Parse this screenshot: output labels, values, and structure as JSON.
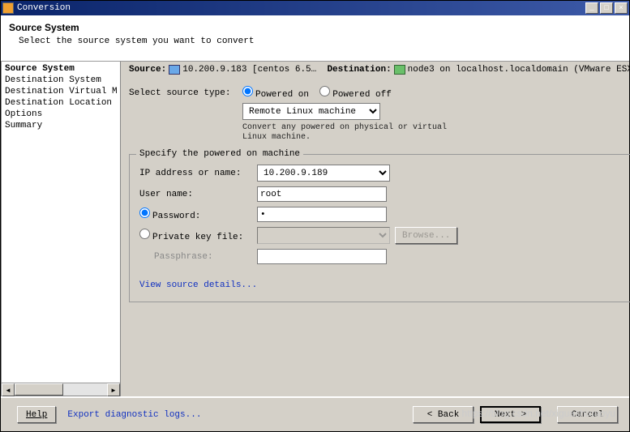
{
  "titlebar": {
    "title": "Conversion"
  },
  "header": {
    "title": "Source System",
    "subtitle": "Select the source system you want to convert"
  },
  "sidebar": {
    "items": [
      "Source System",
      "Destination System",
      "Destination Virtual M",
      "Destination Location",
      "Options",
      "Summary"
    ]
  },
  "srcline": {
    "source_label": "Source:",
    "source_val": "10.200.9.183 [centos 6.5…",
    "dest_label": "Destination:",
    "dest_val": "node3 on localhost.localdomain (VMware ESX…"
  },
  "form": {
    "select_type_label": "Select source type:",
    "radio_on": "Powered on",
    "radio_off": "Powered off",
    "machine_type": "Remote Linux machine",
    "hint": "Convert any powered on physical or virtual\nLinux machine.",
    "fieldset_legend": "Specify the powered on machine",
    "ip_label": "IP address or name:",
    "ip_val": "10.200.9.189",
    "user_label": "User name:",
    "user_val": "root",
    "pw_label": "Password:",
    "pw_val": "•",
    "pk_label": "Private key file:",
    "browse": "Browse...",
    "pp_label": "Passphrase:",
    "view_details": "View source details..."
  },
  "footer": {
    "help": "Help",
    "export": "Export diagnostic logs...",
    "back": "< Back",
    "next": "Next >",
    "cancel": "Cancel"
  },
  "watermark": "https://blog.csdn.net/xiguashixiaoyu"
}
